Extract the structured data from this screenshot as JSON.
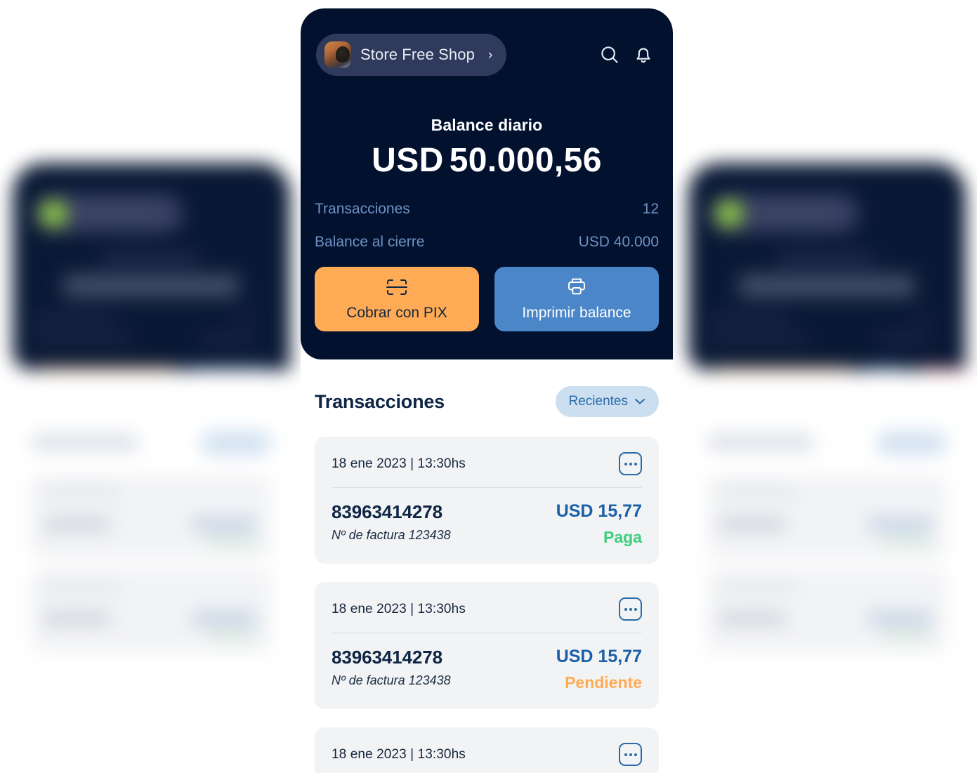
{
  "header": {
    "store_name": "Store Free Shop",
    "chevron": "›",
    "avatar_icon": "store-avatar-photo",
    "search_icon": "search-icon",
    "bell_icon": "notification-bell-icon"
  },
  "balance": {
    "label": "Balance diario",
    "currency": "USD",
    "amount": "50.000,56",
    "stats": [
      {
        "label": "Transacciones",
        "value": "12"
      },
      {
        "label": "Balance al cierre",
        "value": "USD 40.000"
      }
    ]
  },
  "actions": {
    "pix": {
      "label": "Cobrar con PIX",
      "icon": "scan-qr-icon",
      "color": "#FFAB55"
    },
    "print": {
      "label": "Imprimir balance",
      "icon": "printer-icon",
      "color": "#4A86C8"
    }
  },
  "transactions_section": {
    "title": "Transacciones",
    "sort_label": "Recientes",
    "sort_icon": "chevron-down-icon"
  },
  "transactions": [
    {
      "date": "18 ene 2023 | 13:30hs",
      "id": "83963414278",
      "invoice": "Nº de factura 123438",
      "amount": "USD 15,77",
      "status": "Paga",
      "status_color": "#3DCE7E",
      "more_icon": "more-options-icon"
    },
    {
      "date": "18 ene 2023 | 13:30hs",
      "id": "83963414278",
      "invoice": "Nº de factura 123438",
      "amount": "USD 15,77",
      "status": "Pendiente",
      "status_color": "#FFAB55",
      "more_icon": "more-options-icon"
    },
    {
      "date": "18 ene 2023 | 13:30hs",
      "id": "",
      "invoice": "",
      "amount": "",
      "status": "",
      "status_color": "",
      "more_icon": "more-options-icon"
    }
  ],
  "colors": {
    "header_bg": "#02112E",
    "pill_bg": "#303A5C",
    "accent_orange": "#FFAB55",
    "accent_blue": "#4A86C8",
    "link_blue": "#1A5FA8",
    "muted_blue": "#6F91C4",
    "card_bg": "#F2F3F4",
    "chip_bg": "#CBDFF1",
    "green": "#3DCE7E",
    "red": "#F2484F"
  }
}
